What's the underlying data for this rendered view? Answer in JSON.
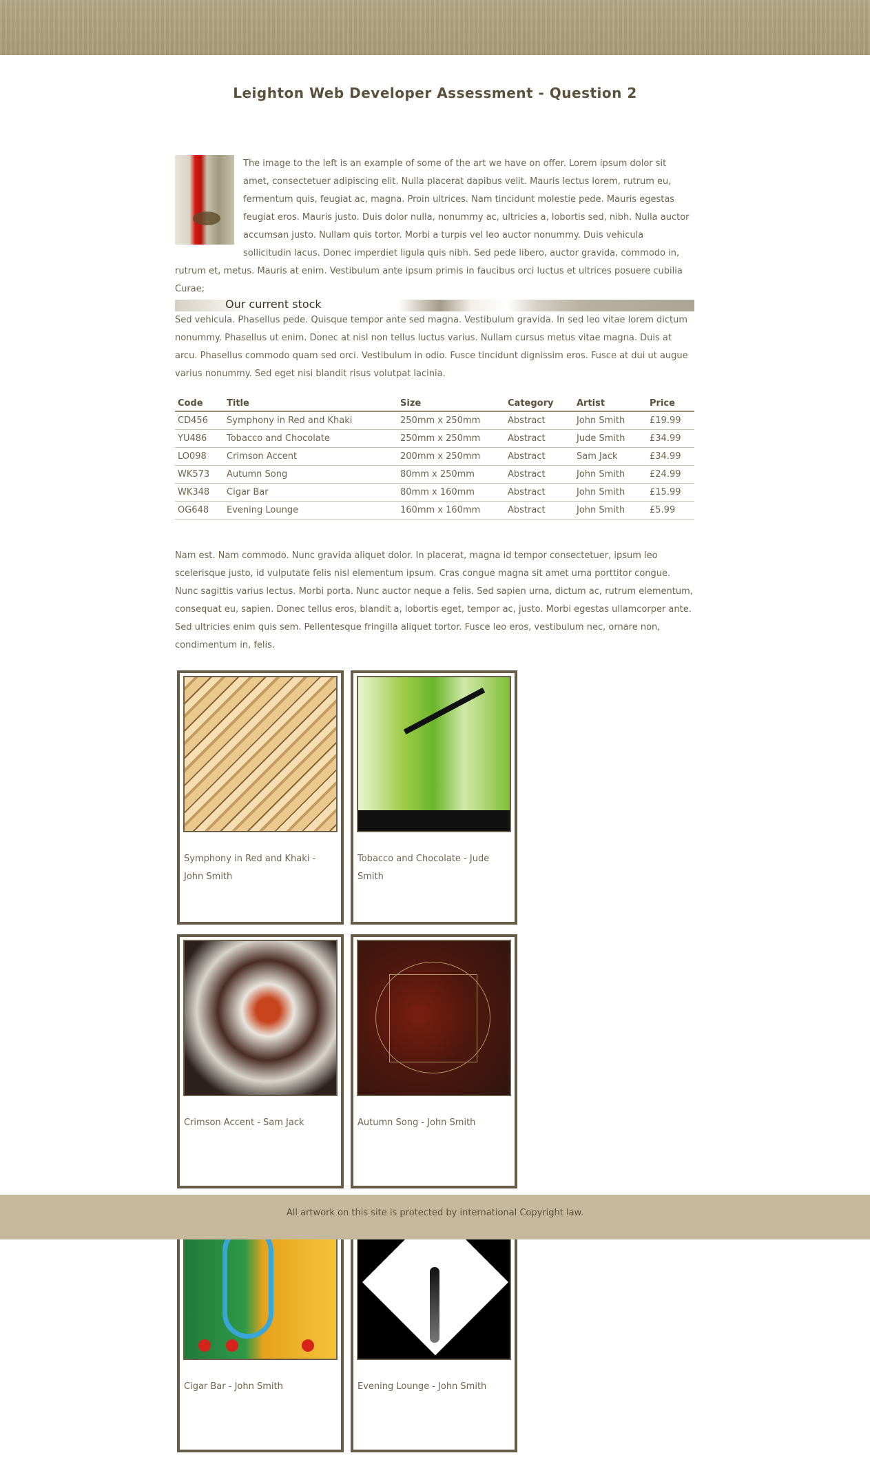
{
  "title": "Leighton Web Developer Assessment - Question 2",
  "intro": "The image to the left is an example of some of the art we have on offer. Lorem ipsum dolor sit amet, consectetuer adipiscing elit. Nulla placerat dapibus velit. Mauris lectus lorem, rutrum eu, fermentum quis, feugiat ac, magna. Proin ultrices. Nam tincidunt molestie pede. Mauris egestas feugiat eros. Mauris justo. Duis dolor nulla, nonummy ac, ultricies a, lobortis sed, nibh. Nulla auctor accumsan justo. Nullam quis tortor. Morbi a turpis vel leo auctor nonummy. Duis vehicula sollicitudin lacus. Donec imperdiet ligula quis nibh. Sed pede libero, auctor gravida, commodo in, rutrum et, metus. Mauris at enim. Vestibulum ante ipsum primis in faucibus orci luctus et ultrices posuere cubilia Curae;",
  "stock_heading": "Our current stock",
  "stock_paragraph": "Sed vehicula. Phasellus pede. Quisque tempor ante sed magna. Vestibulum gravida. In sed leo vitae lorem dictum nonummy. Phasellus ut enim. Donec at nisl non tellus luctus varius. Nullam cursus metus vitae magna. Duis at arcu. Phasellus commodo quam sed orci. Vestibulum in odio. Fusce tincidunt dignissim eros. Fusce at dui ut augue varius nonummy. Sed eget nisi blandit risus volutpat lacinia.",
  "table": {
    "headers": [
      "Code",
      "Title",
      "Size",
      "Category",
      "Artist",
      "Price"
    ],
    "rows": [
      [
        "CD456",
        "Symphony in Red and Khaki",
        "250mm x 250mm",
        "Abstract",
        "John Smith",
        "£19.99"
      ],
      [
        "YU486",
        "Tobacco and Chocolate",
        "250mm x 250mm",
        "Abstract",
        "Jude Smith",
        "£34.99"
      ],
      [
        "LO098",
        "Crimson Accent",
        "200mm x 250mm",
        "Abstract",
        "Sam Jack",
        "£34.99"
      ],
      [
        "WK573",
        "Autumn Song",
        "80mm x 250mm",
        "Abstract",
        "John Smith",
        "£24.99"
      ],
      [
        "WK348",
        "Cigar Bar",
        "80mm x 160mm",
        "Abstract",
        "John Smith",
        "£15.99"
      ],
      [
        "OG648",
        "Evening Lounge",
        "160mm x 160mm",
        "Abstract",
        "John Smith",
        "£5.99"
      ]
    ]
  },
  "closing_paragraph": "Nam est. Nam commodo. Nunc gravida aliquet dolor. In placerat, magna id tempor consectetuer, ipsum leo scelerisque justo, id vulputate felis nisl elementum ipsum. Cras congue magna sit amet urna porttitor congue. Nunc sagittis varius lectus. Morbi porta. Nunc auctor neque a felis. Sed sapien urna, dictum ac, rutrum elementum, consequat eu, sapien. Donec tellus eros, blandit a, lobortis eget, tempor ac, justo. Morbi egestas ullamcorper ante. Sed ultricies enim quis sem. Pellentesque fringilla aliquet tortor. Fusce leo eros, vestibulum nec, ornare non, condimentum in, felis.",
  "gallery": [
    {
      "caption": "Symphony in Red and Khaki - John Smith"
    },
    {
      "caption": "Tobacco and Chocolate - Jude Smith"
    },
    {
      "caption": "Crimson Accent - Sam Jack"
    },
    {
      "caption": "Autumn Song - John Smith"
    },
    {
      "caption": "Cigar Bar - John Smith"
    },
    {
      "caption": "Evening Lounge - John Smith"
    }
  ],
  "footer": "All artwork on this site is protected by international Copyright law.",
  "colors": {
    "header_band": "#a89a78",
    "footer_band": "#c5b89c",
    "text": "#6e6450",
    "frame": "#665c48"
  }
}
